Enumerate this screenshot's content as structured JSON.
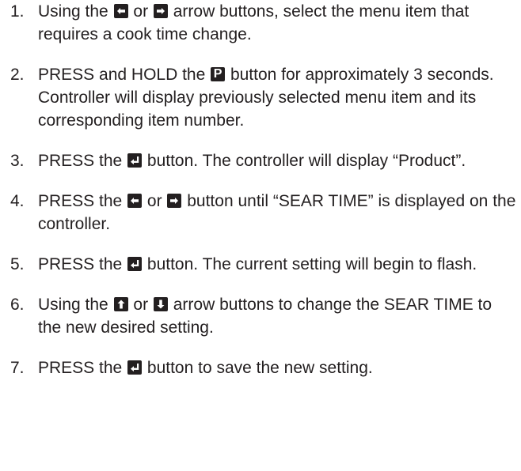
{
  "steps": [
    {
      "number": "1.",
      "parts": [
        {
          "text": "Using the "
        },
        {
          "icon": "left-arrow-button-icon"
        },
        {
          "text": " or "
        },
        {
          "icon": "right-arrow-button-icon"
        },
        {
          "text": " arrow buttons, select the menu item that requires a cook time change."
        }
      ]
    },
    {
      "number": "2.",
      "parts": [
        {
          "text": "PRESS and HOLD the "
        },
        {
          "icon": "p-button-icon",
          "letter": "P"
        },
        {
          "text": " button for approximately 3 seconds. Controller will display previously selected menu item and its corresponding item number."
        }
      ]
    },
    {
      "number": "3.",
      "parts": [
        {
          "text": "PRESS the "
        },
        {
          "icon": "enter-button-icon"
        },
        {
          "text": " button. The controller will display “Product”."
        }
      ]
    },
    {
      "number": "4.",
      "parts": [
        {
          "text": "PRESS the "
        },
        {
          "icon": "left-arrow-button-icon"
        },
        {
          "text": " or "
        },
        {
          "icon": "right-arrow-button-icon"
        },
        {
          "text": " button until “SEAR TIME” is displayed on the controller."
        }
      ]
    },
    {
      "number": "5.",
      "parts": [
        {
          "text": "PRESS the "
        },
        {
          "icon": "enter-button-icon"
        },
        {
          "text": " button. The current setting will begin to flash."
        }
      ]
    },
    {
      "number": "6.",
      "parts": [
        {
          "text": "Using the "
        },
        {
          "icon": "up-arrow-button-icon"
        },
        {
          "text": " or "
        },
        {
          "icon": "down-arrow-button-icon"
        },
        {
          "text": " arrow buttons to change the SEAR TIME to the new desired setting."
        }
      ]
    },
    {
      "number": "7.",
      "parts": [
        {
          "text": "PRESS the "
        },
        {
          "icon": "enter-button-icon"
        },
        {
          "text": " button to save the new setting."
        }
      ]
    }
  ]
}
